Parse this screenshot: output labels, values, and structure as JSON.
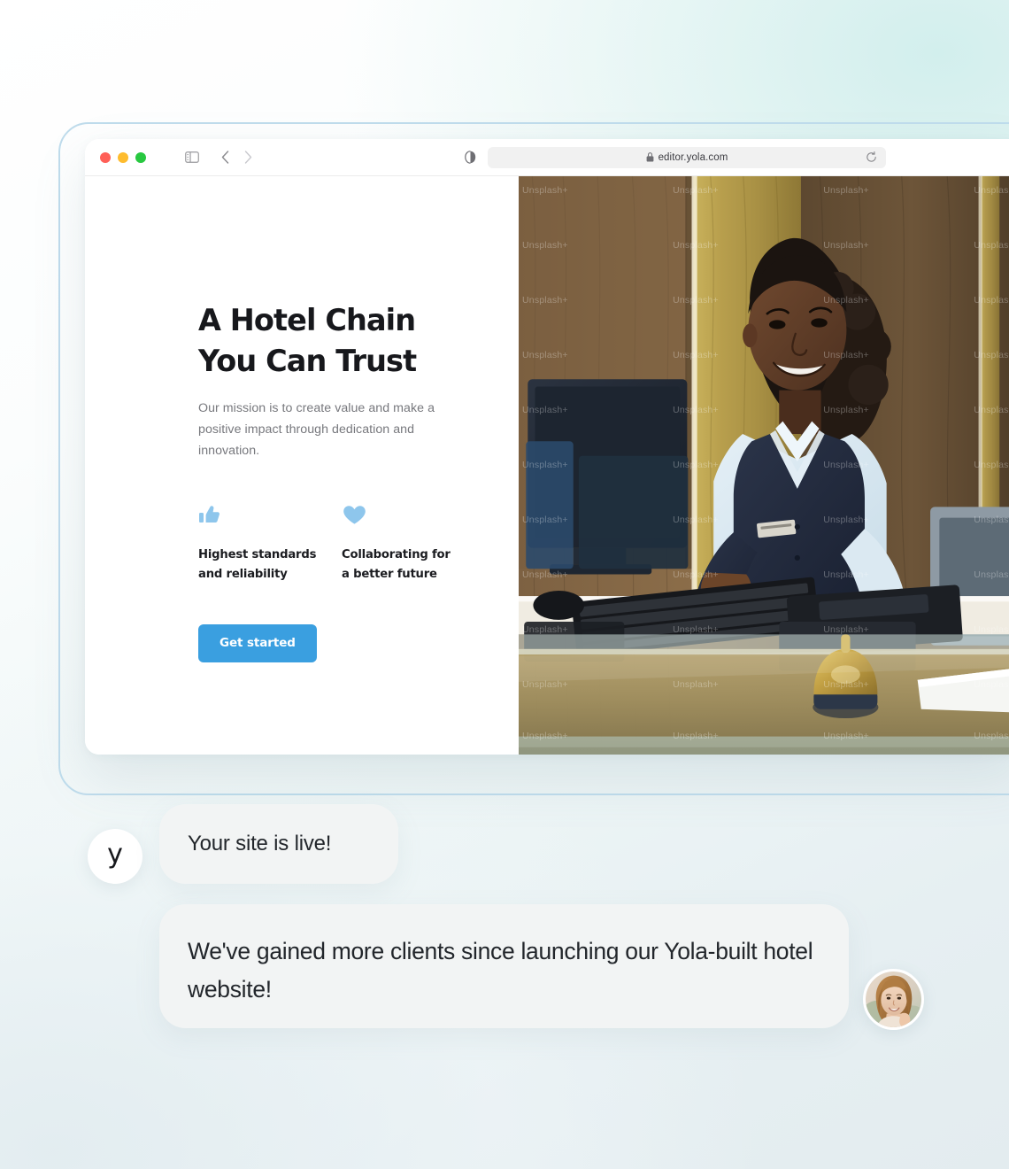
{
  "browser": {
    "traffic_lights": [
      "close",
      "minimize",
      "maximize"
    ],
    "sidebar_toggle_icon": "sidebar-icon",
    "back_icon": "chevron-left-icon",
    "forward_icon": "chevron-right-icon",
    "reader_icon": "reader-view-icon",
    "lock_icon": "lock-icon",
    "url": "editor.yola.com",
    "reload_icon": "reload-icon"
  },
  "site": {
    "title": "A Hotel Chain\nYou Can Trust",
    "subtitle": "Our mission is to create value and make a positive impact through dedication and innovation.",
    "features": [
      {
        "icon": "thumbs-up-icon",
        "label": "Highest standards\nand reliability"
      },
      {
        "icon": "heart-icon",
        "label": "Collaborating for\na better future"
      }
    ],
    "cta_label": "Get started",
    "photo_alt": "hotel-receptionist-photo",
    "photo_watermark": "Unsplash+"
  },
  "chat": {
    "brand_avatar_letter": "y",
    "messages": [
      {
        "text": "Your site is live!",
        "from": "yola"
      },
      {
        "text": "We've gained more clients since launching our Yola-built hotel website!",
        "from": "client"
      }
    ],
    "client_avatar_alt": "client-profile-photo"
  },
  "colors": {
    "accent_blue": "#3a9fe0",
    "icon_blue": "#8ec6ec",
    "bubble_bg": "#f2f4f4",
    "frame_border": "#bfdcec",
    "heading": "#17181c",
    "body_text": "#77787d"
  }
}
